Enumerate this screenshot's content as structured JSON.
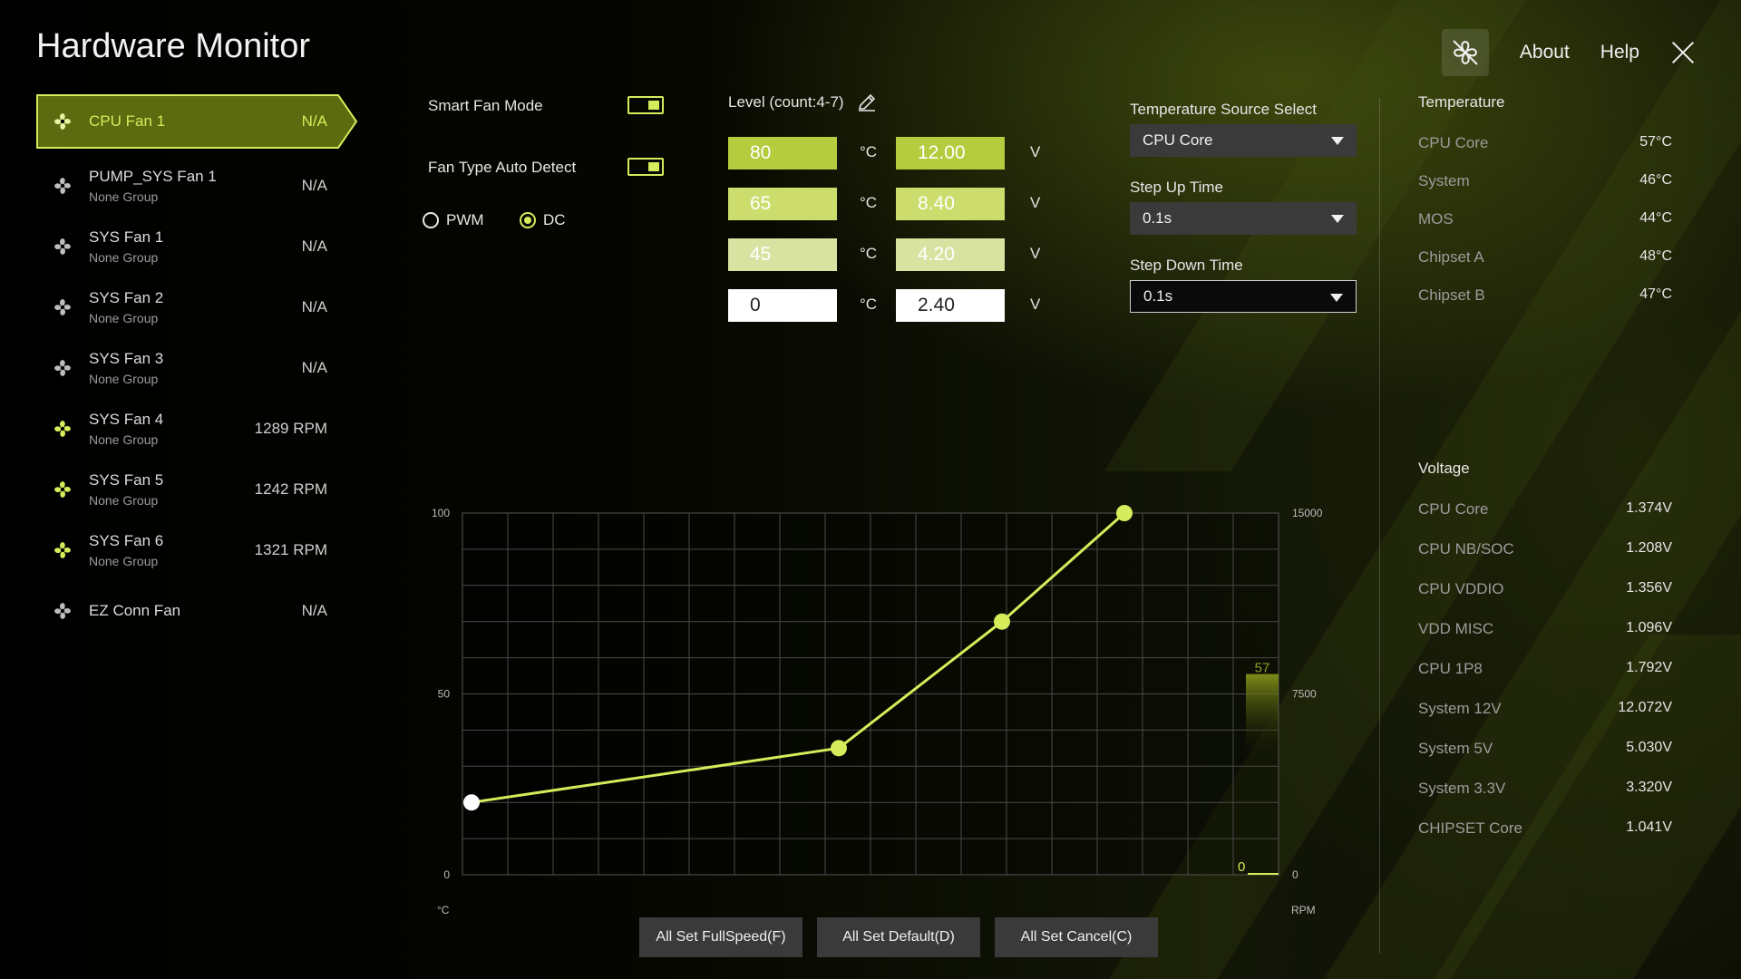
{
  "app": {
    "title": "Hardware Monitor"
  },
  "topbar": {
    "about_label": "About",
    "help_label": "Help"
  },
  "fans": [
    {
      "name": "CPU Fan 1",
      "group": "",
      "speed": "N/A",
      "active": true,
      "spinning": false
    },
    {
      "name": "PUMP_SYS Fan 1",
      "group": "None Group",
      "speed": "N/A",
      "active": false,
      "spinning": false
    },
    {
      "name": "SYS Fan 1",
      "group": "None Group",
      "speed": "N/A",
      "active": false,
      "spinning": false
    },
    {
      "name": "SYS Fan 2",
      "group": "None Group",
      "speed": "N/A",
      "active": false,
      "spinning": false
    },
    {
      "name": "SYS Fan 3",
      "group": "None Group",
      "speed": "N/A",
      "active": false,
      "spinning": false
    },
    {
      "name": "SYS Fan 4",
      "group": "None Group",
      "speed": "1289 RPM",
      "active": false,
      "spinning": true
    },
    {
      "name": "SYS Fan 5",
      "group": "None Group",
      "speed": "1242 RPM",
      "active": false,
      "spinning": true
    },
    {
      "name": "SYS Fan 6",
      "group": "None Group",
      "speed": "1321 RPM",
      "active": false,
      "spinning": true
    },
    {
      "name": "EZ Conn Fan",
      "group": "",
      "speed": "N/A",
      "active": false,
      "spinning": false
    }
  ],
  "controls": {
    "smart_fan_mode_label": "Smart Fan Mode",
    "smart_fan_mode_on": true,
    "fan_type_auto_label": "Fan Type Auto Detect",
    "fan_type_auto_on": true,
    "pwm_label": "PWM",
    "dc_label": "DC",
    "selected_mode": "DC",
    "level_label": "Level (count:4-7)"
  },
  "levels": [
    {
      "temp": "80",
      "volt": "12.00"
    },
    {
      "temp": "65",
      "volt": "8.40"
    },
    {
      "temp": "45",
      "volt": "4.20"
    },
    {
      "temp": "0",
      "volt": "2.40"
    }
  ],
  "units": {
    "temp": "°C",
    "volt": "V"
  },
  "temperature_source": {
    "label": "Temperature Source Select",
    "value": "CPU Core"
  },
  "step_up": {
    "label": "Step Up Time",
    "value": "0.1s"
  },
  "step_down": {
    "label": "Step Down Time",
    "value": "0.1s"
  },
  "temperature": {
    "title": "Temperature",
    "items": [
      {
        "name": "CPU Core",
        "value": "57°C"
      },
      {
        "name": "System",
        "value": "46°C"
      },
      {
        "name": "MOS",
        "value": "44°C"
      },
      {
        "name": "Chipset A",
        "value": "48°C"
      },
      {
        "name": "Chipset B",
        "value": "47°C"
      }
    ]
  },
  "voltage": {
    "title": "Voltage",
    "items": [
      {
        "name": "CPU Core",
        "value": "1.374V"
      },
      {
        "name": "CPU NB/SOC",
        "value": "1.208V"
      },
      {
        "name": "CPU VDDIO",
        "value": "1.356V"
      },
      {
        "name": "VDD MISC",
        "value": "1.096V"
      },
      {
        "name": "CPU 1P8",
        "value": "1.792V"
      },
      {
        "name": "System 12V",
        "value": "12.072V"
      },
      {
        "name": "System 5V",
        "value": "5.030V"
      },
      {
        "name": "System 3.3V",
        "value": "3.320V"
      },
      {
        "name": "CHIPSET Core",
        "value": "1.041V"
      }
    ]
  },
  "chart_data": {
    "type": "line",
    "x_unit": "°C",
    "y_right_unit": "RPM",
    "y_left_ticks": [
      "100",
      "50",
      "0"
    ],
    "y_right_ticks": [
      "15000",
      "7500",
      "0"
    ],
    "ylim_left": [
      0,
      100
    ],
    "ylim_right": [
      0,
      15000
    ],
    "xlim": [
      0,
      100
    ],
    "grid": true,
    "points": [
      {
        "x": 0,
        "y": 20
      },
      {
        "x": 45,
        "y": 35
      },
      {
        "x": 65,
        "y": 70
      },
      {
        "x": 80,
        "y": 100
      }
    ],
    "current_temp_label": "57",
    "current_temp": 57,
    "current_rpm_label": "0",
    "current_rpm": 0,
    "line_color": "#d6ec5a"
  },
  "actions": {
    "full_speed": "All Set FullSpeed(F)",
    "default": "All Set Default(D)",
    "cancel": "All Set Cancel(C)"
  },
  "colors": {
    "accent": "#d6ec5a",
    "accent_dark": "#5c6a10"
  }
}
